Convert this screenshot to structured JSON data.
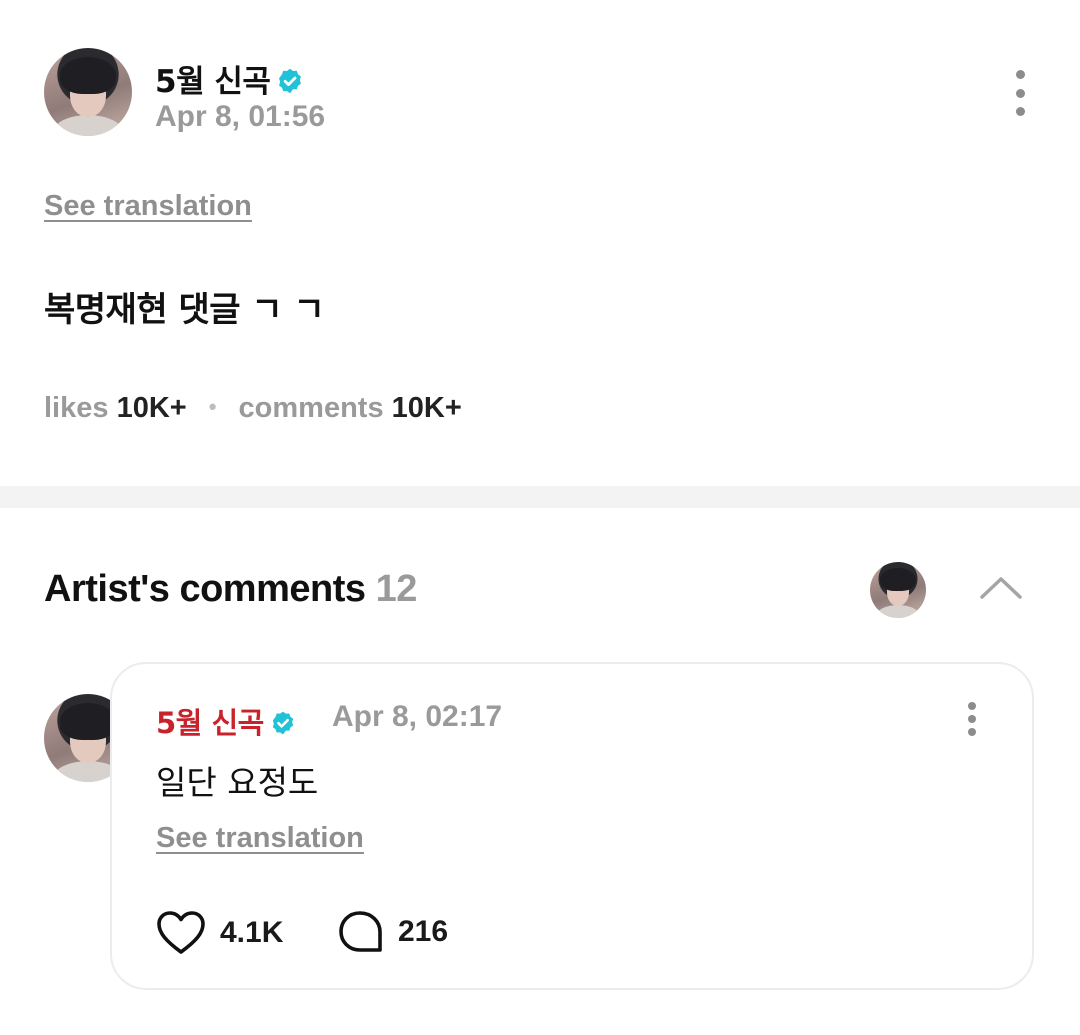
{
  "post": {
    "author": "5월 신곡",
    "date": "Apr 8, 01:56",
    "see_translation": "See translation",
    "body": "복명재현 댓글 ㄱ ㄱ",
    "likes_label": "likes",
    "likes_value": "10K+",
    "comments_label": "comments",
    "comments_value": "10K+"
  },
  "artist_comments": {
    "title": "Artist's comments",
    "count": "12",
    "comment": {
      "author": "5월 신곡",
      "date": "Apr 8, 02:17",
      "text": "일단 요정도",
      "see_translation": "See translation",
      "likes": "4.1K",
      "replies": "216"
    }
  },
  "colors": {
    "verified": "#1fc2d6",
    "artist_name": "#c8232c",
    "muted": "#9a9a9a"
  },
  "icons": [
    "verified-badge-icon",
    "more-vertical-icon",
    "chevron-up-icon",
    "heart-icon",
    "reply-bubble-icon"
  ]
}
